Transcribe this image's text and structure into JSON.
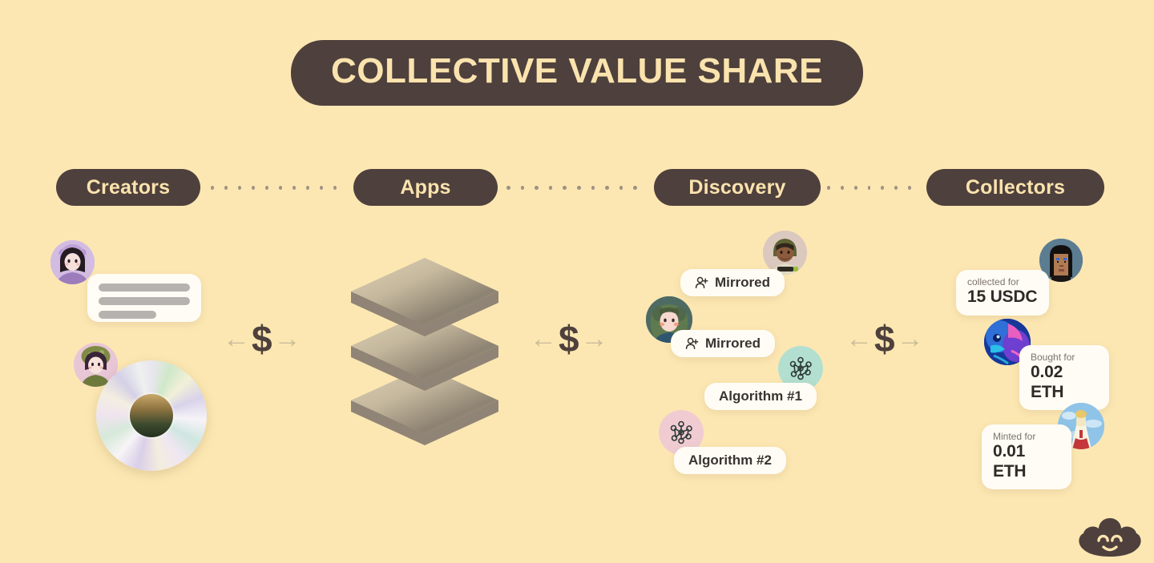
{
  "title": "COLLECTIVE VALUE SHARE",
  "stages": [
    {
      "label": "Creators"
    },
    {
      "label": "Apps"
    },
    {
      "label": "Discovery"
    },
    {
      "label": "Collectors"
    }
  ],
  "flow_symbol": {
    "left_arrow": "←",
    "currency": "$",
    "right_arrow": "→"
  },
  "creators": {
    "post_card_name": "text-post-card",
    "media_name": "music-disc-artwork"
  },
  "apps": {
    "stack_name": "app-layers-stack",
    "layer_count": 3
  },
  "discovery": {
    "items": [
      {
        "label": "Mirrored",
        "icon": "person-plus-icon"
      },
      {
        "label": "Mirrored",
        "icon": "person-plus-icon"
      },
      {
        "label": "Algorithm #1",
        "icon": "network-graph-icon",
        "circle_color": "#B3DFD0"
      },
      {
        "label": "Algorithm #2",
        "icon": "network-graph-icon",
        "circle_color": "#F0CCD2"
      }
    ]
  },
  "collectors": {
    "transactions": [
      {
        "label": "collected for",
        "value": "15 USDC"
      },
      {
        "label": "Bought for",
        "value": "0.02 ETH"
      },
      {
        "label": "Minted for",
        "value": "0.01 ETH"
      }
    ]
  },
  "branding": {
    "logo_name": "lens-cloud-logo"
  },
  "colors": {
    "background": "#FCE7B2",
    "dark": "#4E403C",
    "cream_text": "#FBE3AE",
    "card": "#FFFCF5",
    "dot": "#A09284",
    "arrow": "#CBBB9A"
  }
}
